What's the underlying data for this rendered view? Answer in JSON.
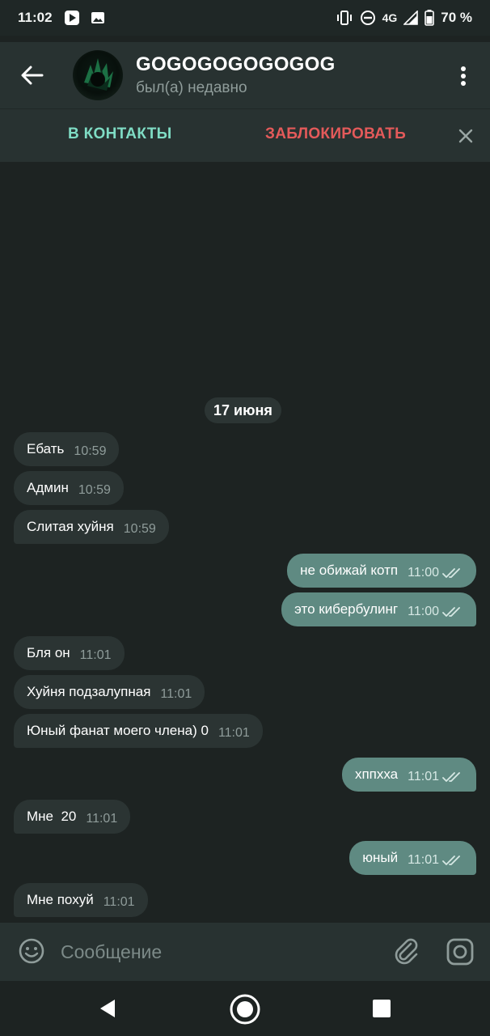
{
  "status_bar": {
    "time": "11:02",
    "network": "4G",
    "battery": "70 %",
    "icons": [
      "play-store-icon",
      "image-icon",
      "vibrate-icon",
      "do-not-disturb-icon",
      "signal-icon",
      "battery-icon"
    ]
  },
  "header": {
    "name": "GOGOGOGOGOGOG",
    "status": "был(а) недавно"
  },
  "action_bar": {
    "add_contact": "В КОНТАКТЫ",
    "block": "ЗАБЛОКИРОВАТЬ"
  },
  "chat": {
    "date": "17 июня",
    "messages": [
      {
        "dir": "in",
        "text": "Ебать",
        "time": "10:59"
      },
      {
        "dir": "in",
        "text": "Админ",
        "time": "10:59"
      },
      {
        "dir": "in",
        "text": "Слитая хуйня",
        "time": "10:59"
      },
      {
        "dir": "out",
        "text": "не обижай котп",
        "time": "11:00",
        "read": true
      },
      {
        "dir": "out",
        "text": "это кибербулинг",
        "time": "11:00",
        "read": true
      },
      {
        "dir": "in",
        "text": "Бля он",
        "time": "11:01"
      },
      {
        "dir": "in",
        "text": "Хуйня подзалупная",
        "time": "11:01"
      },
      {
        "dir": "in",
        "text": "Юный фанат моего члена) 0",
        "time": "11:01"
      },
      {
        "dir": "out",
        "text": "хппхха",
        "time": "11:01",
        "read": true
      },
      {
        "dir": "in",
        "text": "Мне  20",
        "time": "11:01"
      },
      {
        "dir": "out",
        "text": "юный",
        "time": "11:01",
        "read": true
      },
      {
        "dir": "in",
        "text": "Мне похуй",
        "time": "11:01"
      }
    ]
  },
  "input": {
    "placeholder": "Сообщение",
    "value": ""
  },
  "colors": {
    "background": "#1d2322",
    "bar": "#283231",
    "incoming": "#2b3433",
    "outgoing": "#5f8a82",
    "accent": "#7fdcc4",
    "danger": "#e45a5a"
  }
}
